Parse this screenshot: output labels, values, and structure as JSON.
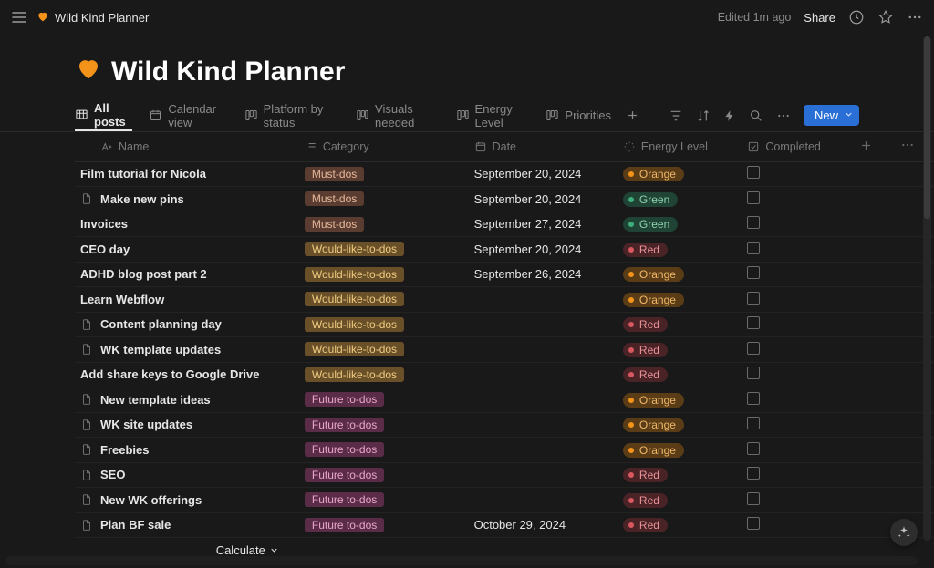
{
  "topbar": {
    "title": "Wild Kind Planner",
    "edited": "Edited 1m ago",
    "share": "Share"
  },
  "page": {
    "title": "Wild Kind Planner"
  },
  "views": [
    {
      "label": "All posts",
      "icon": "table",
      "active": true
    },
    {
      "label": "Calendar view",
      "icon": "calendar",
      "active": false
    },
    {
      "label": "Platform by status",
      "icon": "board",
      "active": false
    },
    {
      "label": "Visuals needed",
      "icon": "board",
      "active": false
    },
    {
      "label": "Energy Level",
      "icon": "board",
      "active": false
    },
    {
      "label": "Priorities",
      "icon": "board",
      "active": false
    }
  ],
  "toolbar": {
    "new_label": "New"
  },
  "columns": {
    "name": "Name",
    "category": "Category",
    "date": "Date",
    "energy": "Energy Level",
    "completed": "Completed"
  },
  "categories": {
    "must": "Must-dos",
    "would": "Would-like-to-dos",
    "future": "Future to-dos"
  },
  "energy": {
    "orange": "Orange",
    "green": "Green",
    "red": "Red"
  },
  "rows": [
    {
      "name": "Film tutorial for Nicola",
      "icon": false,
      "category": "must",
      "date": "September 20, 2024",
      "energy": "orange"
    },
    {
      "name": "Make new pins",
      "icon": true,
      "category": "must",
      "date": "September 20, 2024",
      "energy": "green"
    },
    {
      "name": "Invoices",
      "icon": false,
      "category": "must",
      "date": "September 27, 2024",
      "energy": "green"
    },
    {
      "name": "CEO day",
      "icon": false,
      "category": "would",
      "date": "September 20, 2024",
      "energy": "red"
    },
    {
      "name": "ADHD blog post part 2",
      "icon": false,
      "category": "would",
      "date": "September 26, 2024",
      "energy": "orange"
    },
    {
      "name": "Learn Webflow",
      "icon": false,
      "category": "would",
      "date": "",
      "energy": "orange"
    },
    {
      "name": "Content planning day",
      "icon": true,
      "category": "would",
      "date": "",
      "energy": "red"
    },
    {
      "name": "WK template updates",
      "icon": true,
      "category": "would",
      "date": "",
      "energy": "red"
    },
    {
      "name": "Add share keys to Google Drive",
      "icon": false,
      "category": "would",
      "date": "",
      "energy": "red"
    },
    {
      "name": "New template ideas",
      "icon": true,
      "category": "future",
      "date": "",
      "energy": "orange"
    },
    {
      "name": "WK site updates",
      "icon": true,
      "category": "future",
      "date": "",
      "energy": "orange"
    },
    {
      "name": "Freebies",
      "icon": true,
      "category": "future",
      "date": "",
      "energy": "orange"
    },
    {
      "name": "SEO",
      "icon": true,
      "category": "future",
      "date": "",
      "energy": "red"
    },
    {
      "name": "New WK offerings",
      "icon": true,
      "category": "future",
      "date": "",
      "energy": "red"
    },
    {
      "name": "Plan BF sale",
      "icon": true,
      "category": "future",
      "date": "October 29, 2024",
      "energy": "red"
    }
  ],
  "footer": {
    "calculate": "Calculate"
  }
}
